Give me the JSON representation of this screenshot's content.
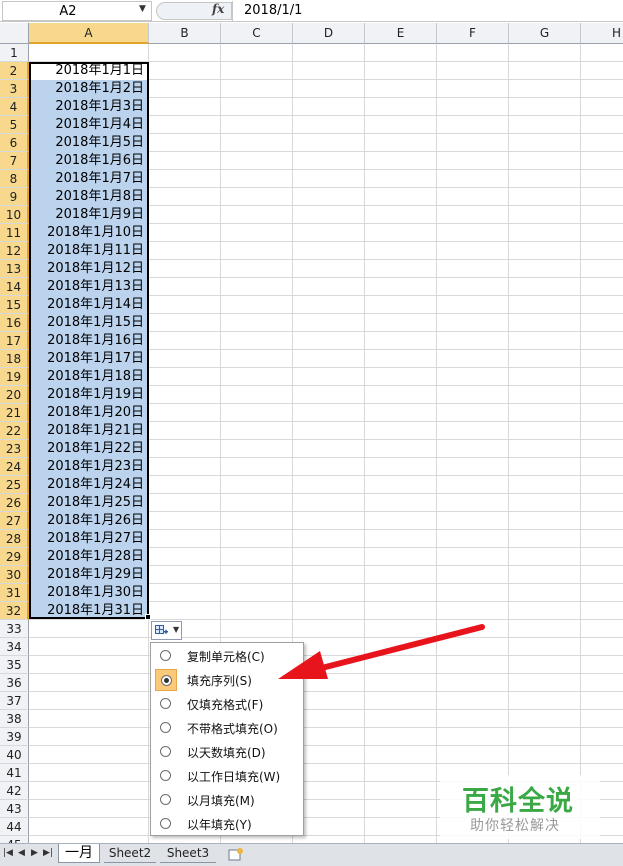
{
  "formula_bar": {
    "name_box": "A2",
    "fx_label": "fx",
    "formula": "2018/1/1"
  },
  "columns": [
    "A",
    "B",
    "C",
    "D",
    "E",
    "F",
    "G",
    "H"
  ],
  "rows": [
    "1",
    "2",
    "3",
    "4",
    "5",
    "6",
    "7",
    "8",
    "9",
    "10",
    "11",
    "12",
    "13",
    "14",
    "15",
    "16",
    "17",
    "18",
    "19",
    "20",
    "21",
    "22",
    "23",
    "24",
    "25",
    "26",
    "27",
    "28",
    "29",
    "30",
    "31",
    "32",
    "33",
    "34",
    "35",
    "36",
    "37",
    "38",
    "39",
    "40",
    "41",
    "42",
    "43",
    "44",
    "45"
  ],
  "cells_A": [
    "2018年1月1日",
    "2018年1月2日",
    "2018年1月3日",
    "2018年1月4日",
    "2018年1月5日",
    "2018年1月6日",
    "2018年1月7日",
    "2018年1月8日",
    "2018年1月9日",
    "2018年1月10日",
    "2018年1月11日",
    "2018年1月12日",
    "2018年1月13日",
    "2018年1月14日",
    "2018年1月15日",
    "2018年1月16日",
    "2018年1月17日",
    "2018年1月18日",
    "2018年1月19日",
    "2018年1月20日",
    "2018年1月21日",
    "2018年1月22日",
    "2018年1月23日",
    "2018年1月24日",
    "2018年1月25日",
    "2018年1月26日",
    "2018年1月27日",
    "2018年1月28日",
    "2018年1月29日",
    "2018年1月30日",
    "2018年1月31日"
  ],
  "autofill_menu": {
    "items": [
      {
        "label": "复制单元格(C)",
        "checked": false
      },
      {
        "label": "填充序列(S)",
        "checked": true
      },
      {
        "label": "仅填充格式(F)",
        "checked": false
      },
      {
        "label": "不带格式填充(O)",
        "checked": false
      },
      {
        "label": "以天数填充(D)",
        "checked": false
      },
      {
        "label": "以工作日填充(W)",
        "checked": false
      },
      {
        "label": "以月填充(M)",
        "checked": false
      },
      {
        "label": "以年填充(Y)",
        "checked": false
      }
    ]
  },
  "sheet_tabs": {
    "active": "一月",
    "others": [
      "Sheet2",
      "Sheet3"
    ]
  },
  "watermark": {
    "title": "百科全说",
    "subtitle": "助你轻松解决"
  },
  "colors": {
    "selection": "#bcd3ee",
    "header_highlight": "#f8d88c",
    "arrow": "#e8141c",
    "watermark": "#3aa845"
  },
  "icons": [
    "dropdown-arrow-icon",
    "fx-icon",
    "autofill-options-icon",
    "red-arrow-annotation",
    "sheet-nav-arrows",
    "insert-sheet-icon"
  ]
}
